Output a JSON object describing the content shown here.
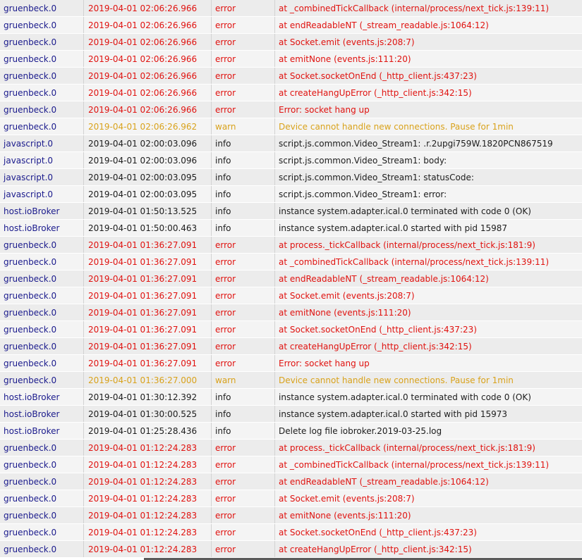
{
  "log": {
    "rows": [
      {
        "from": "gruenbeck.0",
        "time": "2019-04-01 02:06:26.966",
        "severity": "error",
        "message": "at _combinedTickCallback (internal/process/next_tick.js:139:11)"
      },
      {
        "from": "gruenbeck.0",
        "time": "2019-04-01 02:06:26.966",
        "severity": "error",
        "message": "at endReadableNT (_stream_readable.js:1064:12)"
      },
      {
        "from": "gruenbeck.0",
        "time": "2019-04-01 02:06:26.966",
        "severity": "error",
        "message": "at Socket.emit (events.js:208:7)"
      },
      {
        "from": "gruenbeck.0",
        "time": "2019-04-01 02:06:26.966",
        "severity": "error",
        "message": "at emitNone (events.js:111:20)"
      },
      {
        "from": "gruenbeck.0",
        "time": "2019-04-01 02:06:26.966",
        "severity": "error",
        "message": "at Socket.socketOnEnd (_http_client.js:437:23)"
      },
      {
        "from": "gruenbeck.0",
        "time": "2019-04-01 02:06:26.966",
        "severity": "error",
        "message": "at createHangUpError (_http_client.js:342:15)"
      },
      {
        "from": "gruenbeck.0",
        "time": "2019-04-01 02:06:26.966",
        "severity": "error",
        "message": "Error: socket hang up"
      },
      {
        "from": "gruenbeck.0",
        "time": "2019-04-01 02:06:26.962",
        "severity": "warn",
        "message": "Device cannot handle new connections. Pause for 1min"
      },
      {
        "from": "javascript.0",
        "time": "2019-04-01 02:00:03.096",
        "severity": "info",
        "message": "script.js.common.Video_Stream1: .r.2upgi759W.1820PCN867519"
      },
      {
        "from": "javascript.0",
        "time": "2019-04-01 02:00:03.096",
        "severity": "info",
        "message": "script.js.common.Video_Stream1: body:"
      },
      {
        "from": "javascript.0",
        "time": "2019-04-01 02:00:03.095",
        "severity": "info",
        "message": "script.js.common.Video_Stream1: statusCode:"
      },
      {
        "from": "javascript.0",
        "time": "2019-04-01 02:00:03.095",
        "severity": "info",
        "message": "script.js.common.Video_Stream1: error:"
      },
      {
        "from": "host.ioBroker",
        "time": "2019-04-01 01:50:13.525",
        "severity": "info",
        "message": "instance system.adapter.ical.0 terminated with code 0 (OK)"
      },
      {
        "from": "host.ioBroker",
        "time": "2019-04-01 01:50:00.463",
        "severity": "info",
        "message": "instance system.adapter.ical.0 started with pid 15987"
      },
      {
        "from": "gruenbeck.0",
        "time": "2019-04-01 01:36:27.091",
        "severity": "error",
        "message": "at process._tickCallback (internal/process/next_tick.js:181:9)"
      },
      {
        "from": "gruenbeck.0",
        "time": "2019-04-01 01:36:27.091",
        "severity": "error",
        "message": "at _combinedTickCallback (internal/process/next_tick.js:139:11)"
      },
      {
        "from": "gruenbeck.0",
        "time": "2019-04-01 01:36:27.091",
        "severity": "error",
        "message": "at endReadableNT (_stream_readable.js:1064:12)"
      },
      {
        "from": "gruenbeck.0",
        "time": "2019-04-01 01:36:27.091",
        "severity": "error",
        "message": "at Socket.emit (events.js:208:7)"
      },
      {
        "from": "gruenbeck.0",
        "time": "2019-04-01 01:36:27.091",
        "severity": "error",
        "message": "at emitNone (events.js:111:20)"
      },
      {
        "from": "gruenbeck.0",
        "time": "2019-04-01 01:36:27.091",
        "severity": "error",
        "message": "at Socket.socketOnEnd (_http_client.js:437:23)"
      },
      {
        "from": "gruenbeck.0",
        "time": "2019-04-01 01:36:27.091",
        "severity": "error",
        "message": "at createHangUpError (_http_client.js:342:15)"
      },
      {
        "from": "gruenbeck.0",
        "time": "2019-04-01 01:36:27.091",
        "severity": "error",
        "message": "Error: socket hang up"
      },
      {
        "from": "gruenbeck.0",
        "time": "2019-04-01 01:36:27.000",
        "severity": "warn",
        "message": "Device cannot handle new connections. Pause for 1min"
      },
      {
        "from": "host.ioBroker",
        "time": "2019-04-01 01:30:12.392",
        "severity": "info",
        "message": "instance system.adapter.ical.0 terminated with code 0 (OK)"
      },
      {
        "from": "host.ioBroker",
        "time": "2019-04-01 01:30:00.525",
        "severity": "info",
        "message": "instance system.adapter.ical.0 started with pid 15973"
      },
      {
        "from": "host.ioBroker",
        "time": "2019-04-01 01:25:28.436",
        "severity": "info",
        "message": "Delete log file iobroker.2019-03-25.log"
      },
      {
        "from": "gruenbeck.0",
        "time": "2019-04-01 01:12:24.283",
        "severity": "error",
        "message": "at process._tickCallback (internal/process/next_tick.js:181:9)"
      },
      {
        "from": "gruenbeck.0",
        "time": "2019-04-01 01:12:24.283",
        "severity": "error",
        "message": "at _combinedTickCallback (internal/process/next_tick.js:139:11)"
      },
      {
        "from": "gruenbeck.0",
        "time": "2019-04-01 01:12:24.283",
        "severity": "error",
        "message": "at endReadableNT (_stream_readable.js:1064:12)"
      },
      {
        "from": "gruenbeck.0",
        "time": "2019-04-01 01:12:24.283",
        "severity": "error",
        "message": "at Socket.emit (events.js:208:7)"
      },
      {
        "from": "gruenbeck.0",
        "time": "2019-04-01 01:12:24.283",
        "severity": "error",
        "message": "at emitNone (events.js:111:20)"
      },
      {
        "from": "gruenbeck.0",
        "time": "2019-04-01 01:12:24.283",
        "severity": "error",
        "message": "at Socket.socketOnEnd (_http_client.js:437:23)"
      },
      {
        "from": "gruenbeck.0",
        "time": "2019-04-01 01:12:24.283",
        "severity": "error",
        "message": "at createHangUpError (_http_client.js:342:15)"
      }
    ]
  },
  "colors": {
    "error": "#e0120f",
    "warn": "#d9a21b",
    "info": "#1c1c1c",
    "source": "#1a1a8c"
  }
}
